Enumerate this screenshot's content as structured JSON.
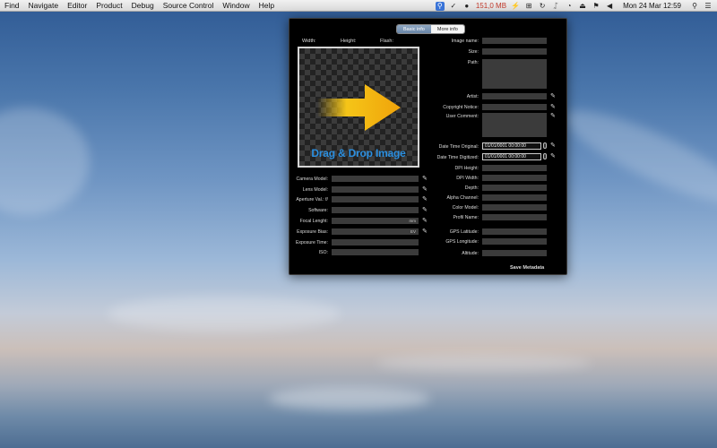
{
  "menubar": {
    "items": [
      "Find",
      "Navigate",
      "Editor",
      "Product",
      "Debug",
      "Source Control",
      "Window",
      "Help"
    ],
    "memory": "151,0 MB",
    "clock": "Mon 24 Mar  12:59"
  },
  "tabs": {
    "basic": "Basic info",
    "more": "More info"
  },
  "dims": {
    "width": "Width:",
    "height": "Height:",
    "flash": "Flash:"
  },
  "drop": {
    "text": "Drag & Drop Image"
  },
  "left_fields": [
    {
      "label": "Camera Model:",
      "value": "",
      "pen": true
    },
    {
      "label": "Lens Model:",
      "value": "",
      "pen": true
    },
    {
      "label": "Aperture Val.: f/",
      "value": "",
      "pen": true
    },
    {
      "label": "Software:",
      "value": "",
      "pen": true
    },
    {
      "label": "Focal Lenght:",
      "value": "mm",
      "pen": true
    },
    {
      "label": "Exposure Bias:",
      "value": "EV",
      "pen": true
    },
    {
      "label": "Exposure Time:",
      "value": "",
      "pen": false
    },
    {
      "label": "ISO:",
      "value": "",
      "pen": false
    }
  ],
  "right_fields": {
    "image_name": "Image name:",
    "size": "Size:",
    "path": "Path:",
    "artist": "Artist:",
    "copyright": "Copyright Notice:",
    "comment": "User Comment:",
    "dt_original": "Date Time Original:",
    "dt_original_val": "01/01/0001 00:00:00",
    "dt_digitized": "Date Time Digitized:",
    "dt_digitized_val": "01/01/0001 00:00:00",
    "dpi_h": "DPI Height:",
    "dpi_w": "DPI Width:",
    "depth": "Depth:",
    "alpha": "Alpha Channel:",
    "color_model": "Color Model:",
    "profile": "Profil Name:",
    "gps_lat": "GPS Latitude:",
    "gps_lon": "GPS Longitude:",
    "altitude": "Altitude:"
  },
  "save_label": "Save Metadata"
}
